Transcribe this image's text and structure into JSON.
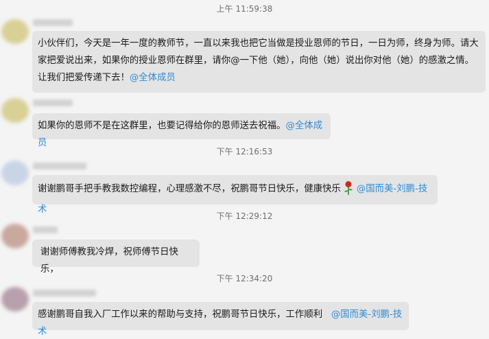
{
  "timestamps": [
    "上午 11:59:38",
    "下午 12:16:53",
    "下午 12:29:12",
    "下午 12:34:20"
  ],
  "messages": [
    {
      "text": "小伙伴们，今天是一年一度的教师节，一直以来我也把它当做是授业恩师的节日，一日为师，终身为师。请大家把爱说出来，如果你的授业恩师在群里，请你@一下他（她），向他（她）说出你对他（她）的感激之情。让我们把爱传递下去！",
      "mention": "@全体成员"
    },
    {
      "text": "如果你的恩师不是在这群里，也要记得给你的恩师送去祝福。",
      "mention": "@全体成员"
    },
    {
      "text": "谢谢鹏哥手把手教我数控编程，心理感激不尽，祝鹏哥节日快乐，健康快乐",
      "emoji": "rose-icon",
      "mention": "@国而美-刘鹏-技术"
    },
    {
      "text": "谢谢师傅教我冷焊，祝师傅节日快乐，"
    },
    {
      "text": "感谢鹏哥自我入厂工作以来的帮助与支持，祝鹏哥节日快乐，工作顺利",
      "mention": "@国而美-刘鹏-技术"
    }
  ],
  "colors": {
    "background": "#f4f4f4",
    "bubble": "#e4e4e4",
    "mention": "#2e8bd6",
    "timestamp": "#6d6d6d"
  }
}
